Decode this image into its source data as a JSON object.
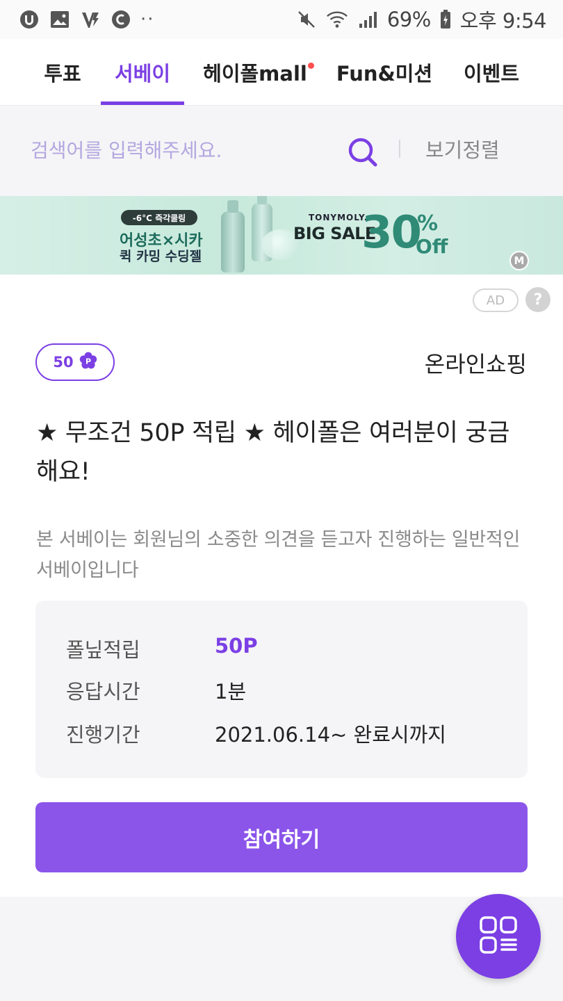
{
  "status_bar": {
    "battery": "69%",
    "time": "오후 9:54",
    "dots": "··"
  },
  "tabs": [
    {
      "label": "투표"
    },
    {
      "label": "서베이"
    },
    {
      "label": "헤이폴mall"
    },
    {
      "label": "Fun&미션"
    },
    {
      "label": "이벤트"
    }
  ],
  "active_tab": "서베이",
  "search": {
    "placeholder": "검색어를 입력해주세요.",
    "sort_label": "보기정렬"
  },
  "banner": {
    "tag": "-6°C 즉각쿨링",
    "line1": "어성초×시카",
    "line2": "퀵 카밍 수딩젤",
    "brand": "TONYMOLY.",
    "headline": "BIG SALE",
    "discount": "30",
    "discount_sign": "%",
    "discount_suffix": "Off",
    "badge": "M"
  },
  "ad_label": "AD",
  "help_glyph": "?",
  "survey": {
    "points_badge": "50",
    "category": "온라인쇼핑",
    "title": "★ 무조건 50P 적립 ★ 헤이폴은 여러분이 궁금해요!",
    "description": "본 서베이는 회원님의 소중한 의견을 듣고자 진행하는 일반적인 서베이입니다",
    "info": {
      "reward_label": "폴닢적립",
      "reward_value": "50P",
      "time_label": "응답시간",
      "time_value": "1분",
      "period_label": "진행기간",
      "period_value": "2021.06.14~ 완료시까지"
    },
    "cta": "참여하기"
  },
  "colors": {
    "accent": "#7b3fe4",
    "cta": "#8b55ea",
    "notify_dot": "#ff4d4d"
  }
}
